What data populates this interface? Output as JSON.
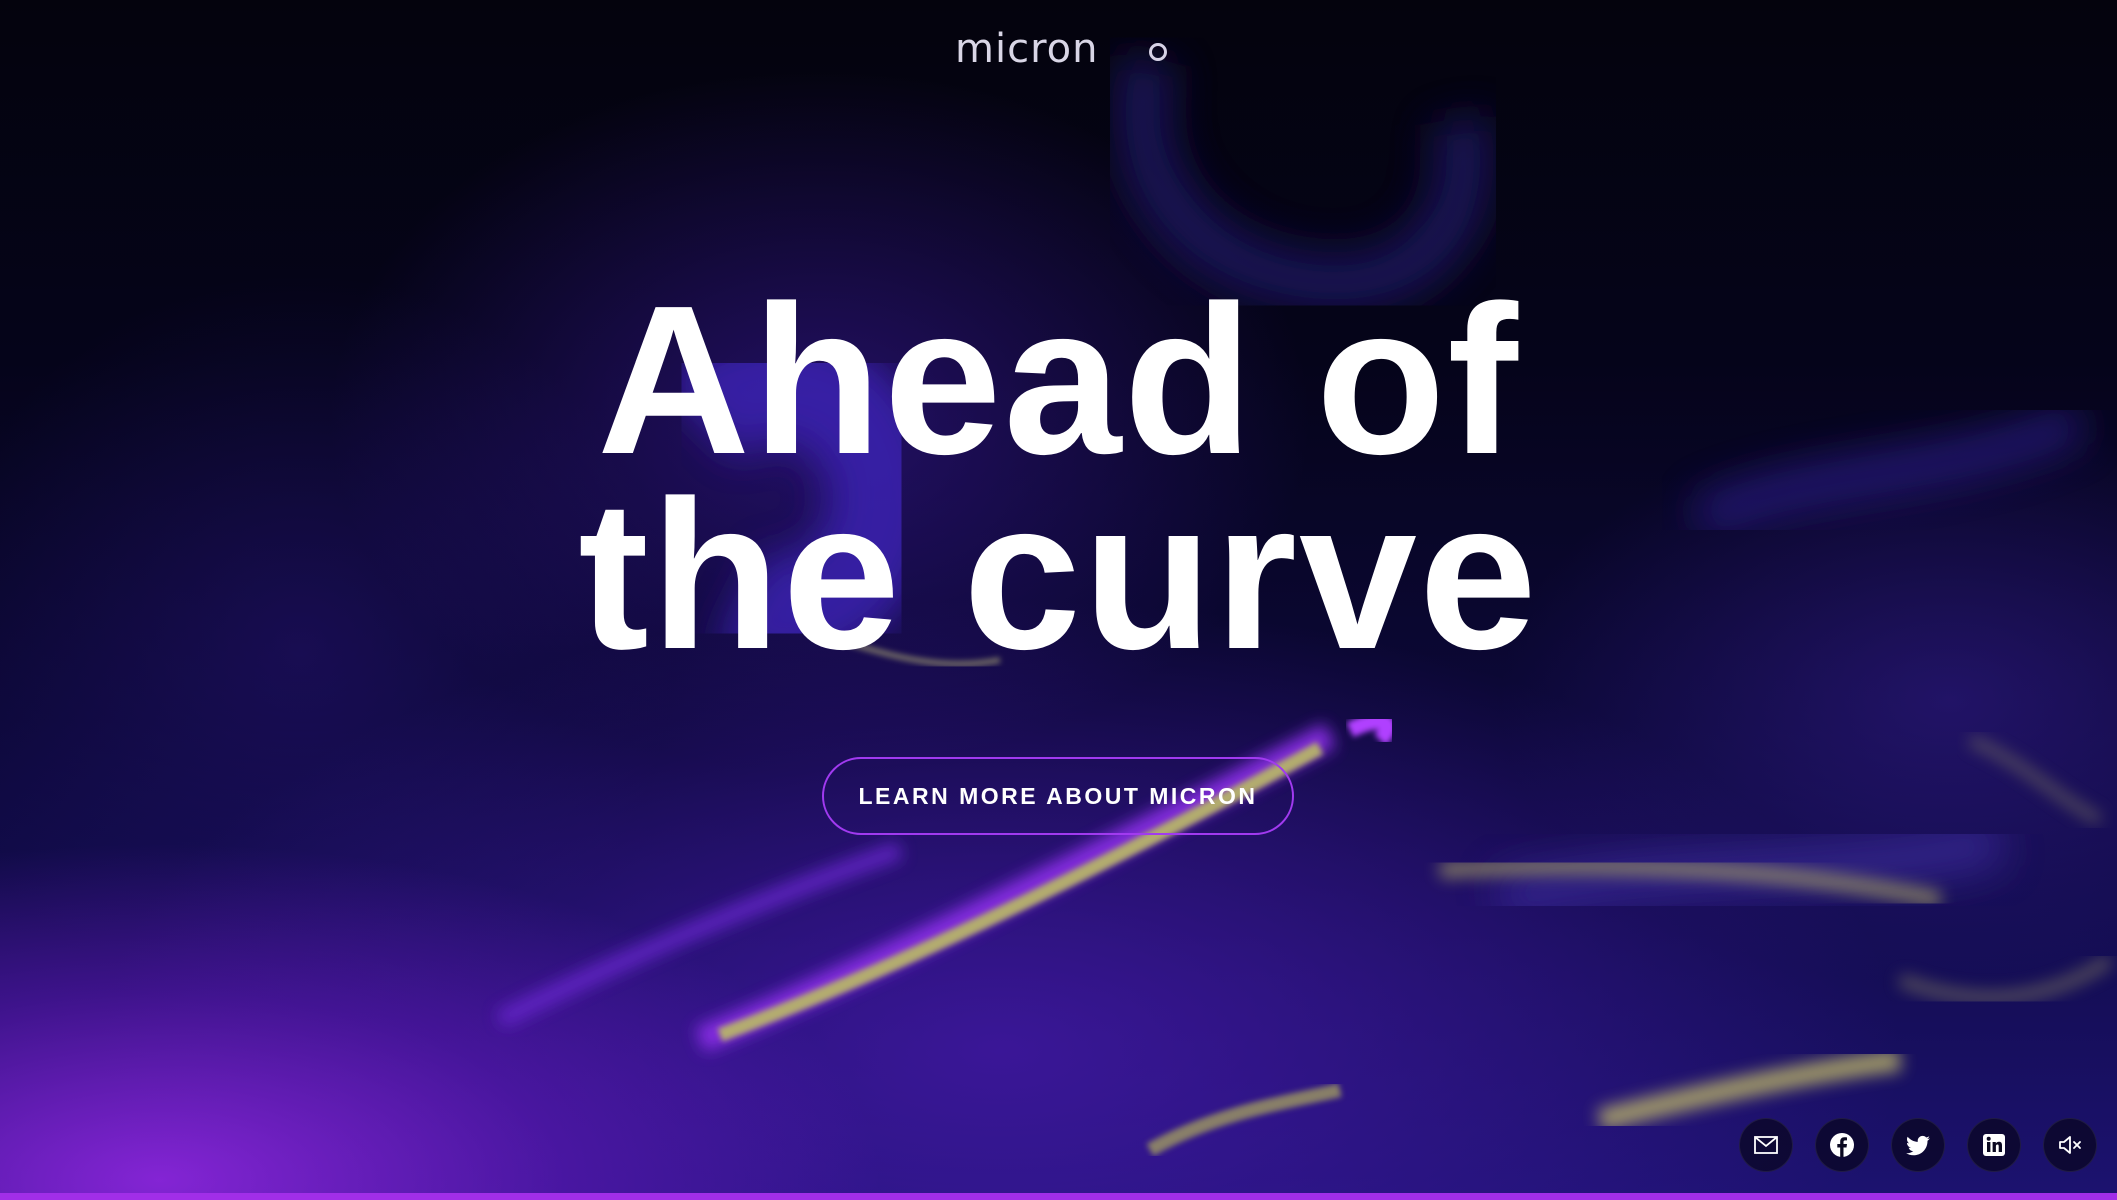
{
  "brand": {
    "logo_text": "micron",
    "logo_icon": "micron-wordmark-icon",
    "menu_icon": "circle-menu-icon"
  },
  "hero": {
    "headline_line1": "Ahead of",
    "headline_line2": "the curve",
    "cta_label": "LEARN MORE ABOUT MICRON"
  },
  "socials": [
    {
      "name": "email",
      "icon": "mail-icon"
    },
    {
      "name": "facebook",
      "icon": "facebook-icon"
    },
    {
      "name": "twitter",
      "icon": "twitter-icon"
    },
    {
      "name": "linkedin",
      "icon": "linkedin-icon"
    },
    {
      "name": "sound",
      "icon": "speaker-muted-icon"
    }
  ],
  "colors": {
    "accent": "#a12ee8",
    "button_border": "#a13af0",
    "text": "#ffffff",
    "background": "#03020c"
  }
}
